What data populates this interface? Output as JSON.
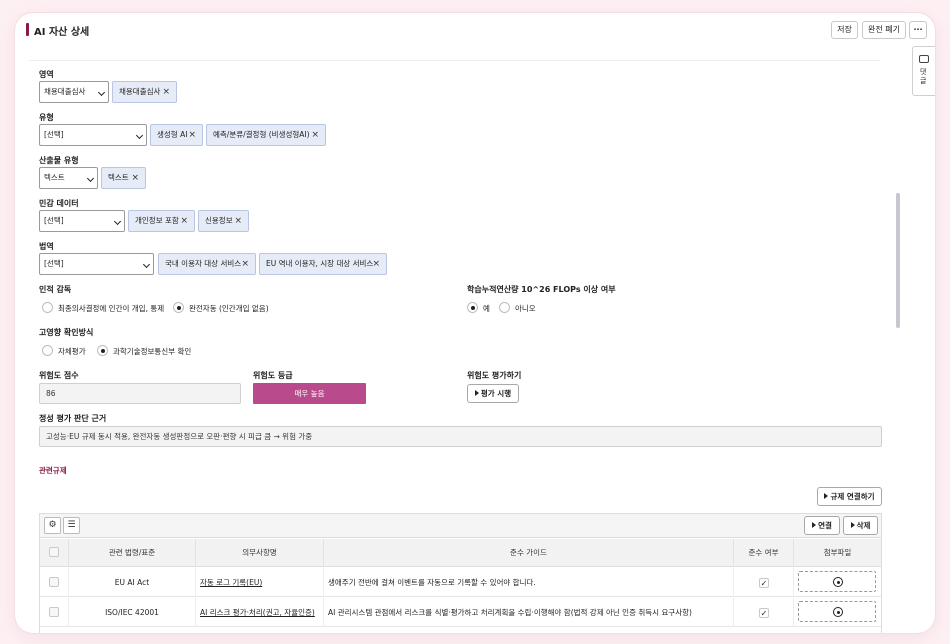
{
  "header": {
    "title": "AI 자산 상세",
    "save": "저장",
    "discard": "완전 폐기",
    "more": "···"
  },
  "side_tab": {
    "label": "댓글"
  },
  "fields": {
    "domain": {
      "label": "영역",
      "select": "채용대출심사",
      "tags": [
        "채용대출심사"
      ]
    },
    "type": {
      "label": "유형",
      "select": "[선택]",
      "tags": [
        "생성형 AI",
        "예측/분류/결정형 (비생성형AI)"
      ]
    },
    "output_type": {
      "label": "산출물 유형",
      "select": "텍스트",
      "tags": [
        "텍스트"
      ]
    },
    "sensitive_data": {
      "label": "민감 데이터",
      "select": "[선택]",
      "tags": [
        "개인정보 포함",
        "신용정보"
      ]
    },
    "jurisdiction": {
      "label": "법역",
      "select": "[선택]",
      "tags": [
        "국내 이용자 대상 서비스",
        "EU 역내 이용자, 시장 대상 서비스"
      ]
    },
    "human_oversight": {
      "label": "인적 감독",
      "options": [
        "최종의사결정에 인간이 개입, 통제",
        "완전자동 (인간개입 없음)"
      ],
      "selected": 1
    },
    "flops": {
      "label": "학습누적연산량 10^26 FLOPs 이상 여부",
      "options": [
        "예",
        "아니오"
      ],
      "selected": 0
    },
    "high_impact": {
      "label": "고영향 확인방식",
      "options": [
        "자체평가",
        "과학기술정보통신부 확인"
      ],
      "selected": 1
    },
    "risk_score": {
      "label": "위험도 점수",
      "value": "86"
    },
    "risk_level": {
      "label": "위험도 등급",
      "value": "매우 높음",
      "color": "#b94b8c"
    },
    "risk_eval": {
      "label": "위험도 평가하기",
      "button": "평가 시행"
    },
    "qualitative": {
      "label": "정성 평가 판단 근거",
      "value": "고성능·EU 규제 동시 적용, 완전자동 생성판정으로 오판·편향 시 피급 큼 → 위험 가중"
    }
  },
  "regulations": {
    "title": "관련규제",
    "link_button": "규제 연결하기",
    "toolbar": {
      "connect": "연결",
      "delete": "삭제"
    },
    "columns": [
      "관련 법령/표준",
      "의무사항명",
      "준수 가이드",
      "준수 여부",
      "첨부파일"
    ],
    "rows": [
      {
        "law": "EU AI Act",
        "obligation": "자동 로그 기록(EU)",
        "guide": "생애주기 전반에 걸쳐 이벤트를 자동으로 기록할 수 있어야 합니다.",
        "compliant": true
      },
      {
        "law": "ISO/IEC 42001",
        "obligation": "AI 리스크 평가·처리(권고, 자율인증)",
        "guide": "AI 관리시스템 관점에서 리스크를 식별·평가하고 처리계획을 수립·이행해야 함(법적 강제 아닌 인증 취득시 요구사항)",
        "compliant": true
      }
    ]
  },
  "accent": "#8a1a4a"
}
